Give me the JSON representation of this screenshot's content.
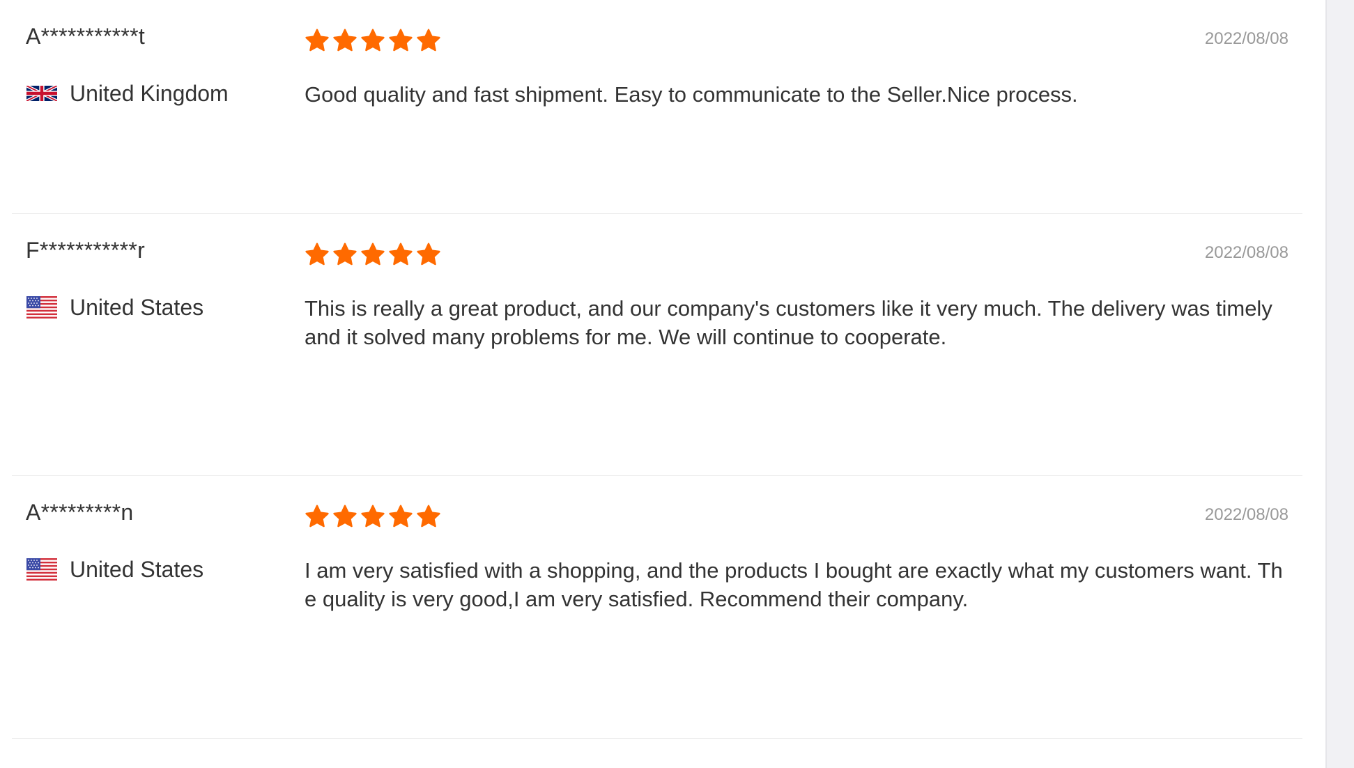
{
  "colors": {
    "star": "#ff6a00",
    "text": "#333333",
    "date": "#999999",
    "divider": "#ececec"
  },
  "reviews": [
    {
      "author": "A***********t",
      "country": "United Kingdom",
      "flag_icon": "uk-flag-icon",
      "rating": 5,
      "date": "2022/08/08",
      "comment": "Good quality and fast shipment. Easy to communicate to the Seller.Nice process."
    },
    {
      "author": "F***********r",
      "country": "United States",
      "flag_icon": "us-flag-icon",
      "rating": 5,
      "date": "2022/08/08",
      "comment": "This is really a great product, and our company's customers like it very much. The delivery was timely and it solved many problems for me. We will continue to cooperate."
    },
    {
      "author": "A*********n",
      "country": "United States",
      "flag_icon": "us-flag-icon",
      "rating": 5,
      "date": "2022/08/08",
      "comment": "I am very satisfied with a shopping, and the products I bought are exactly what my customers want. The quality is very good,I am very satisfied. Recommend their company."
    }
  ]
}
